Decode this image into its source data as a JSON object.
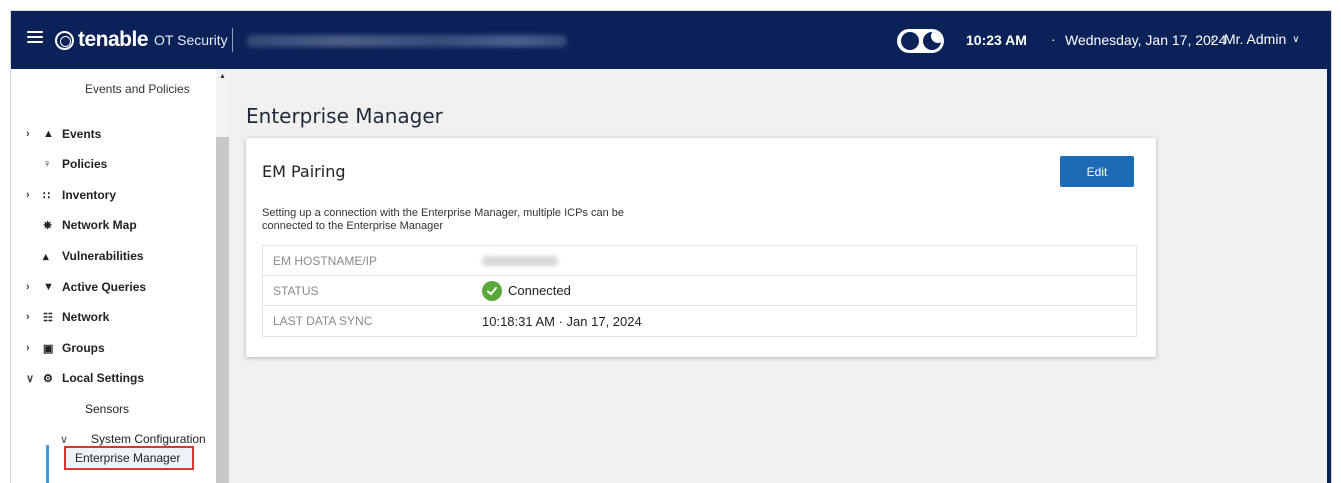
{
  "topbar": {
    "brand_name": "tenable",
    "brand_product": "OT Security",
    "time": "10:23 AM",
    "separator": "·",
    "date": "Wednesday, Jan 17, 2024",
    "user": "Mr. Admin",
    "colors": {
      "bar": "#0b2259"
    }
  },
  "sidebar": {
    "heading": "Events and Policies",
    "items": [
      {
        "label": "Events",
        "icon": "bell-icon"
      },
      {
        "label": "Policies",
        "icon": "policy-icon"
      },
      {
        "label": "Inventory",
        "icon": "inventory-icon"
      },
      {
        "label": "Network Map",
        "icon": "network-map-icon"
      },
      {
        "label": "Vulnerabilities",
        "icon": "vulnerabilities-icon"
      },
      {
        "label": "Active Queries",
        "icon": "shield-icon"
      },
      {
        "label": "Network",
        "icon": "network-icon"
      },
      {
        "label": "Groups",
        "icon": "groups-icon"
      },
      {
        "label": "Local Settings",
        "icon": "settings-icon"
      }
    ],
    "sensors": "Sensors",
    "system_configuration": "System Configuration",
    "active_item": "Enterprise Manager"
  },
  "main": {
    "page_title": "Enterprise Manager",
    "card": {
      "title": "EM Pairing",
      "edit_label": "Edit",
      "description": "Setting up a connection with the Enterprise Manager, multiple ICPs can be connected to the Enterprise Manager",
      "rows": [
        {
          "key": "EM HOSTNAME/IP"
        },
        {
          "key": "STATUS",
          "value": "Connected"
        },
        {
          "key": "LAST DATA SYNC",
          "value": "10:18:31 AM · Jan 17, 2024"
        }
      ]
    },
    "colors": {
      "edit_button": "#1e6bb5",
      "status_ok": "#5aa73c",
      "highlight": "#d9372e"
    }
  }
}
